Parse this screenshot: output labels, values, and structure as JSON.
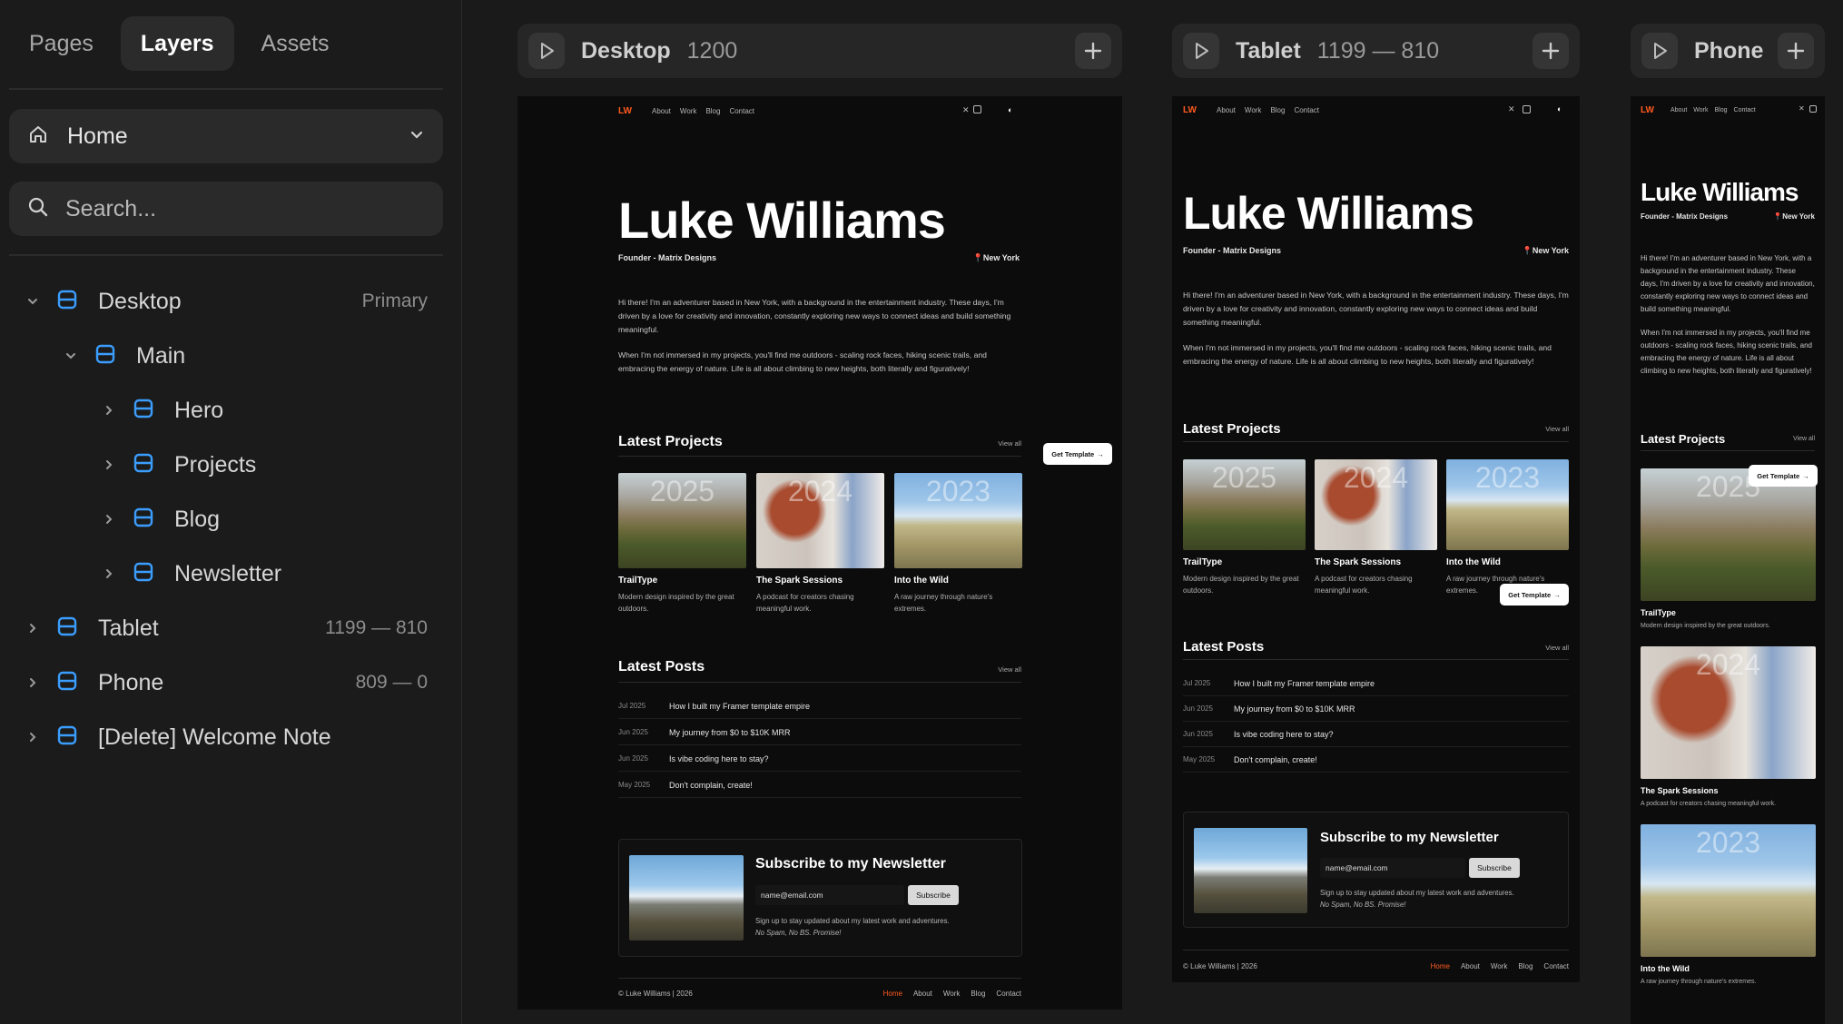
{
  "panel": {
    "tabs": [
      "Pages",
      "Layers",
      "Assets"
    ],
    "active_tab": "Layers",
    "page_selector": "Home",
    "search_placeholder": "Search...",
    "tree": [
      {
        "name": "Desktop",
        "meta": "Primary",
        "expanded": true
      },
      {
        "name": "Main",
        "meta": "",
        "expanded": true
      },
      {
        "name": "Hero",
        "meta": "",
        "expanded": false
      },
      {
        "name": "Projects",
        "meta": "",
        "expanded": false
      },
      {
        "name": "Blog",
        "meta": "",
        "expanded": false
      },
      {
        "name": "Newsletter",
        "meta": "",
        "expanded": false
      },
      {
        "name": "Tablet",
        "meta": "1199 — 810",
        "expanded": false
      },
      {
        "name": "Phone",
        "meta": "809 — 0",
        "expanded": false
      },
      {
        "name": "[Delete] Welcome Note",
        "meta": "",
        "expanded": false
      }
    ]
  },
  "breakpoints": [
    {
      "name": "Desktop",
      "size": "1200"
    },
    {
      "name": "Tablet",
      "size": "1199 — 810"
    },
    {
      "name": "Phone",
      "size": ""
    }
  ],
  "site": {
    "logo": "LW",
    "nav": [
      "About",
      "Work",
      "Blog",
      "Contact"
    ],
    "name": "Luke Williams",
    "role": "Founder - Matrix Designs",
    "location": "📍New York",
    "bio1": "Hi there! I'm an adventurer based in New York, with a background in the entertainment industry. These days, I'm driven by a love for creativity and innovation, constantly exploring new ways to connect ideas and build something meaningful.",
    "bio2": "When I'm not immersed in my projects, you'll find me outdoors - scaling rock faces, hiking scenic trails, and embracing the energy of nature. Life is all about climbing to new heights, both literally and figuratively!",
    "projects_title": "Latest Projects",
    "posts_title": "Latest Posts",
    "view_all": "View all",
    "get_template": "Get Template",
    "projects": [
      {
        "year": "2025",
        "title": "TrailType",
        "desc": "Modern design inspired by the great outdoors."
      },
      {
        "year": "2024",
        "title": "The Spark Sessions",
        "desc": "A podcast for creators chasing meaningful work."
      },
      {
        "year": "2023",
        "title": "Into the Wild",
        "desc": "A raw journey through nature's extremes."
      }
    ],
    "posts": [
      {
        "date": "Jul 2025",
        "title": "How I built my Framer template empire"
      },
      {
        "date": "Jun 2025",
        "title": "My journey from $0 to $10K MRR"
      },
      {
        "date": "Jun 2025",
        "title": "Is vibe coding here to stay?"
      },
      {
        "date": "May 2025",
        "title": "Don't complain, create!"
      }
    ],
    "newsletter_title": "Subscribe to my Newsletter",
    "email_value": "name@email.com",
    "subscribe": "Subscribe",
    "news_note_a": "Sign up to stay updated about my latest work and adventures.",
    "news_note_b": "No Spam, No BS. Promise!",
    "copyright": "© Luke Williams | 2026",
    "footer_links": [
      "Home",
      "About",
      "Work",
      "Blog",
      "Contact"
    ]
  },
  "colors": {
    "accent": "#ff5a1f",
    "frame_icon": "#3b9eff",
    "canvas_bg": "#1a1a1a"
  }
}
